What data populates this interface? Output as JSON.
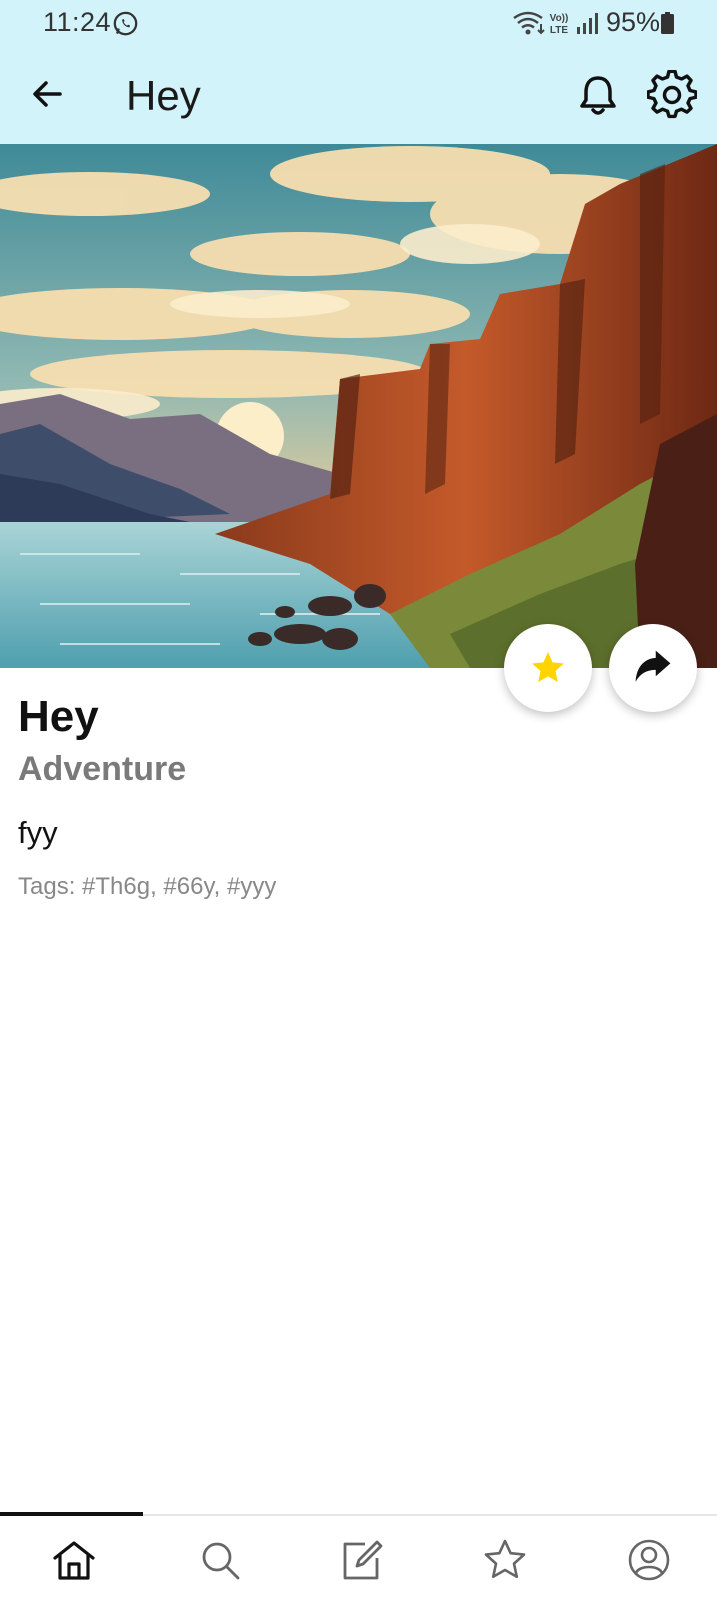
{
  "status_bar": {
    "time": "11:24",
    "battery": "95%",
    "icons": [
      "whatsapp-icon",
      "wifi-icon",
      "volte-icon",
      "signal-icon",
      "battery-icon"
    ]
  },
  "app_bar": {
    "title": "Hey",
    "icons": [
      "back-arrow-icon",
      "bell-icon",
      "gear-icon"
    ]
  },
  "hero": {
    "description_icon": "landscape-illustration",
    "actions": [
      "star-icon",
      "share-icon"
    ]
  },
  "post": {
    "title": "Hey",
    "category": "Adventure",
    "body": "fyy",
    "tags": "Tags: #Th6g, #66y, #yyy"
  },
  "bottom_nav": {
    "items": [
      "home-icon",
      "search-icon",
      "edit-icon",
      "star-outline-icon",
      "profile-icon"
    ],
    "active_index": 0
  },
  "colors": {
    "header_bg": "#d2f3fa",
    "star_fill": "#ffd400",
    "category_text": "#7a7a7a",
    "tags_text": "#888888"
  }
}
